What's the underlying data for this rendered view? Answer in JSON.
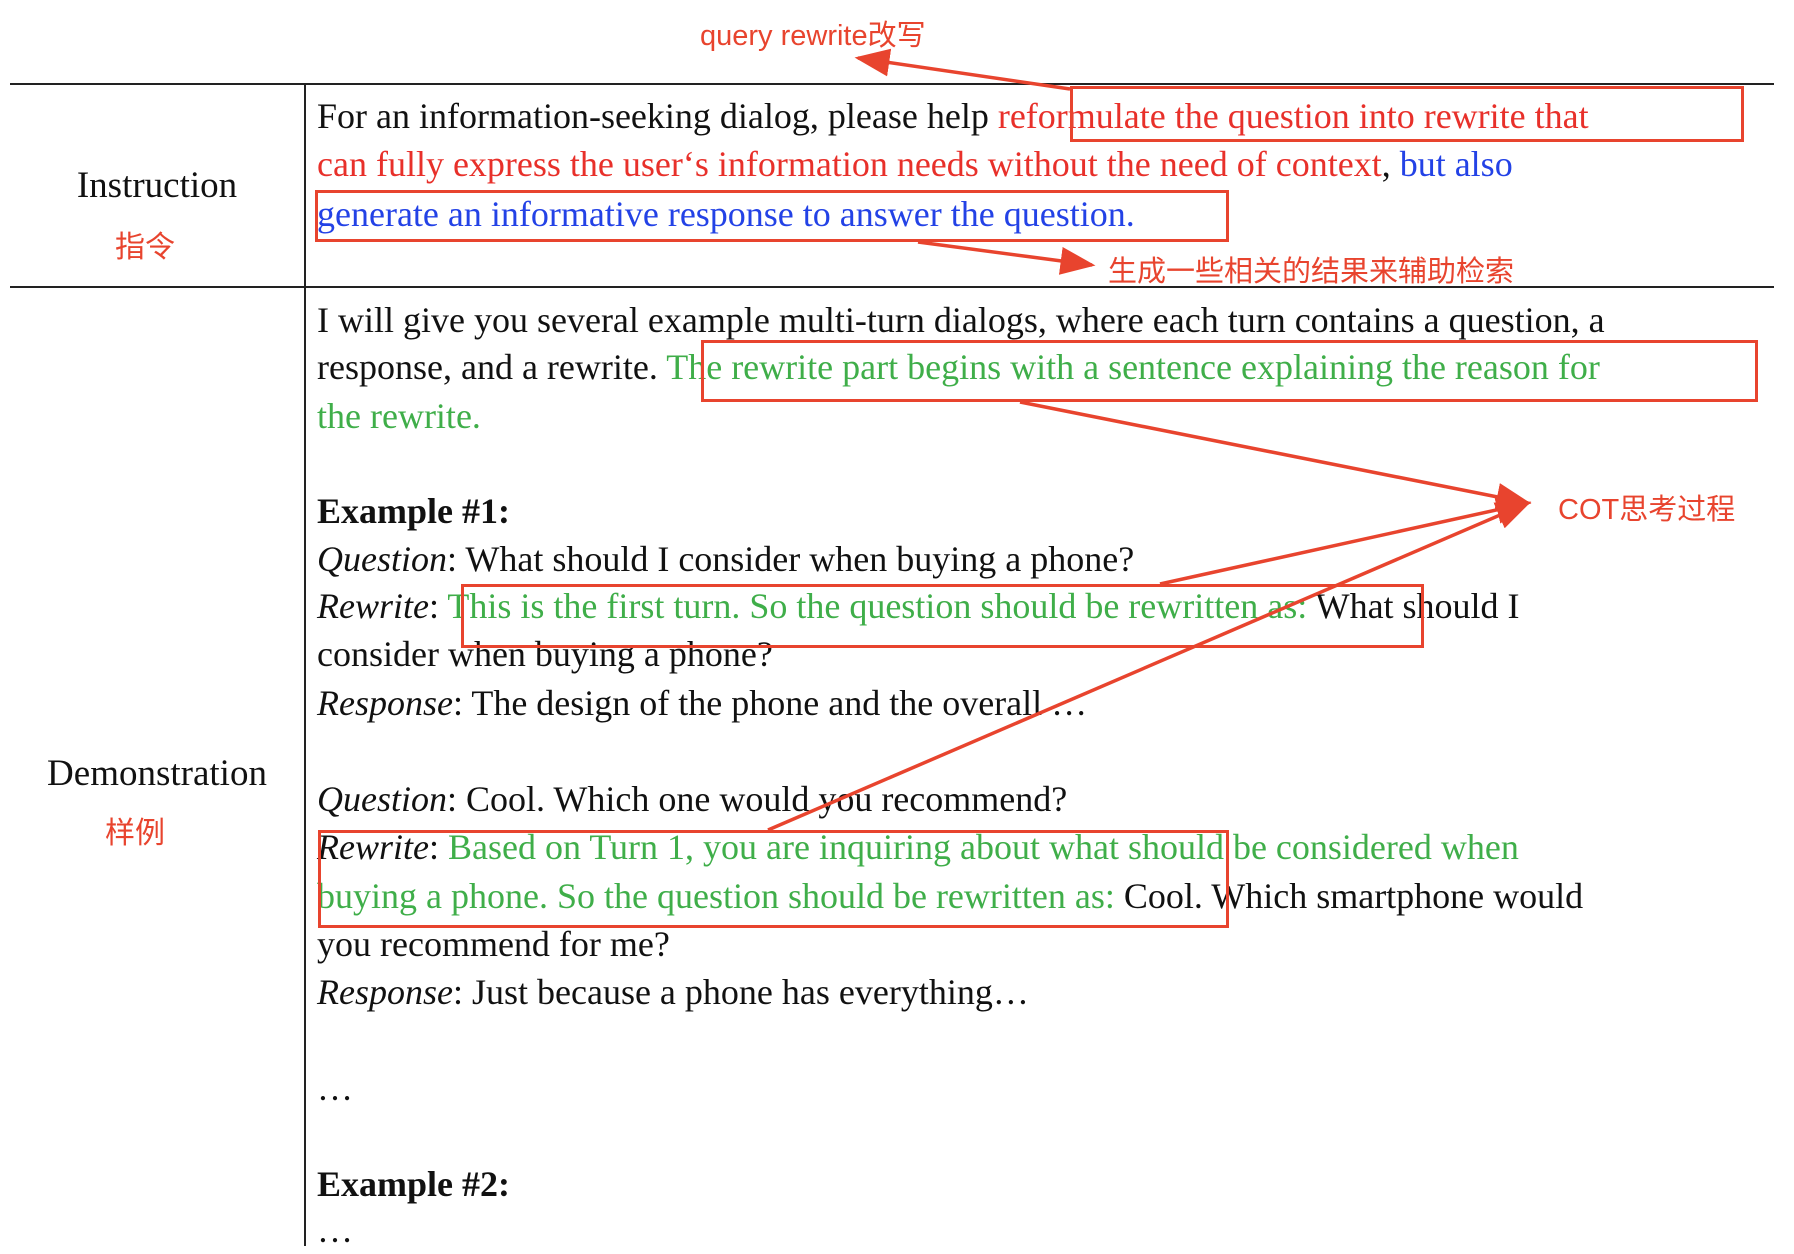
{
  "annotations": {
    "rewrite": "query rewrite改写",
    "generate": "生成一些相关的结果来辅助检索",
    "cot": "COT思考过程"
  },
  "rows": {
    "instruction": {
      "label": "Instruction",
      "label_cn": "指令"
    },
    "demonstration": {
      "label": "Demonstration",
      "label_cn": "样例"
    }
  },
  "instruction": {
    "l1_plain": "For an information-seeking dialog, please help ",
    "l1_red": "reformulate the question into rewrite that",
    "l2_red": "can fully express the user‘s information needs without the need of context",
    "l2_comma": ", ",
    "l2_blue": "but also",
    "l3_blue": "generate an informative response to answer the question."
  },
  "demo": {
    "intro1": "I will give you several example multi-turn dialogs, where each turn contains a question, a",
    "intro2_plain": "response, and a rewrite. ",
    "intro2_green": "The rewrite part begins with a sentence explaining the reason for",
    "intro3_green": "the rewrite.",
    "ex1_title": "Example #1:",
    "q_label": "Question",
    "rw_label": "Rewrite",
    "resp_label": "Response",
    "colon": ": ",
    "q1": "What should I consider when buying a phone?",
    "rw1_green": "This is the first turn. So the question should be rewritten as:",
    "rw1_plain": " What should I",
    "rw1_line2": "consider when buying a phone?",
    "resp1": "The design of the phone and the overall …",
    "q2": "Cool. Which one would you recommend?",
    "rw2_green": "Based on Turn 1, you are inquiring about what should be considered when",
    "rw2_green2": "buying a phone. So the question should be rewritten as:",
    "rw2_plain": " Cool. Which smartphone would",
    "rw2_line3": "you recommend for me?",
    "resp2": "Just because a phone has everything…",
    "ellipsis": "…",
    "ex2_title": "Example #2:",
    "ellipsis2": "…"
  },
  "colors": {
    "accent_red": "#e8442e",
    "text_red": "#e8302a",
    "text_blue": "#2342e6",
    "text_green": "#3fae49"
  }
}
